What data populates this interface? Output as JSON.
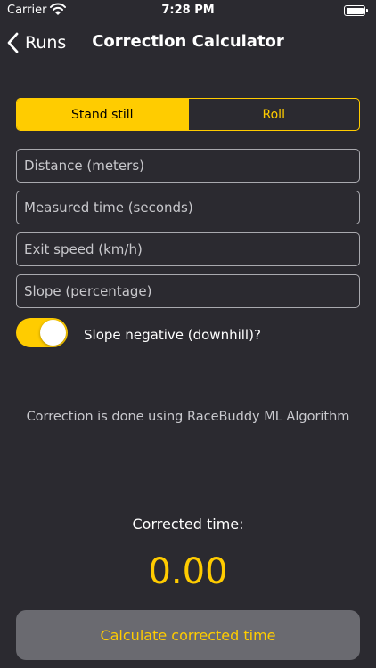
{
  "status_bar": {
    "carrier": "Carrier",
    "time": "7:28 PM",
    "wifi_icon": "wifi-icon",
    "battery_icon": "battery-icon",
    "battery_level": 1.0
  },
  "nav": {
    "back_label": "Runs",
    "back_icon": "chevron-left-icon",
    "title": "Correction Calculator"
  },
  "mode": {
    "options": [
      "Stand still",
      "Roll"
    ],
    "selected": "Stand still"
  },
  "fields": {
    "distance": {
      "placeholder": "Distance (meters)",
      "value": ""
    },
    "time": {
      "placeholder": "Measured time (seconds)",
      "value": ""
    },
    "exit_speed": {
      "placeholder": "Exit speed (km/h)",
      "value": ""
    },
    "slope": {
      "placeholder": "Slope (percentage)",
      "value": ""
    }
  },
  "slope_toggle": {
    "label": "Slope negative (downhill)?",
    "on": true
  },
  "note": "Correction is done using RaceBuddy ML Algorithm",
  "result": {
    "label": "Corrected time:",
    "value": "0.00"
  },
  "calculate_button": "Calculate corrected time",
  "colors": {
    "background": "#2b2a30",
    "accent": "#ffcc00",
    "button_bg": "#6a6a70",
    "field_border": "#a9a9ae"
  }
}
